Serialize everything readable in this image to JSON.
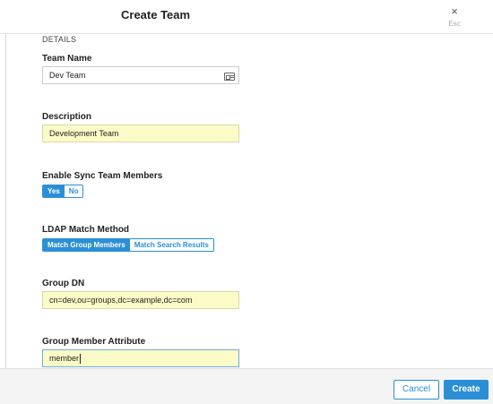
{
  "header": {
    "title": "Create Team",
    "close_icon": "close-icon",
    "close_glyph": "×",
    "esc_label": "Esc"
  },
  "form": {
    "section_label": "DETAILS",
    "team_name": {
      "label": "Team Name",
      "value": "Dev Team",
      "icon": "id-card-icon"
    },
    "description": {
      "label": "Description",
      "value": "Development Team"
    },
    "enable_sync": {
      "label": "Enable Sync Team Members",
      "options": [
        "Yes",
        "No"
      ],
      "selected": "Yes"
    },
    "ldap_match": {
      "label": "LDAP Match Method",
      "options": [
        "Match Group Members",
        "Match Search Results"
      ],
      "selected": "Match Group Members"
    },
    "group_dn": {
      "label": "Group DN",
      "value": "cn=dev,ou=groups,dc=example,dc=com"
    },
    "group_member_attribute": {
      "label": "Group Member Attribute",
      "value": "member"
    }
  },
  "footer": {
    "cancel_label": "Cancel",
    "create_label": "Create"
  },
  "colors": {
    "accent": "#2b8fd6",
    "autofill_yellow": "#fbfbc7"
  }
}
